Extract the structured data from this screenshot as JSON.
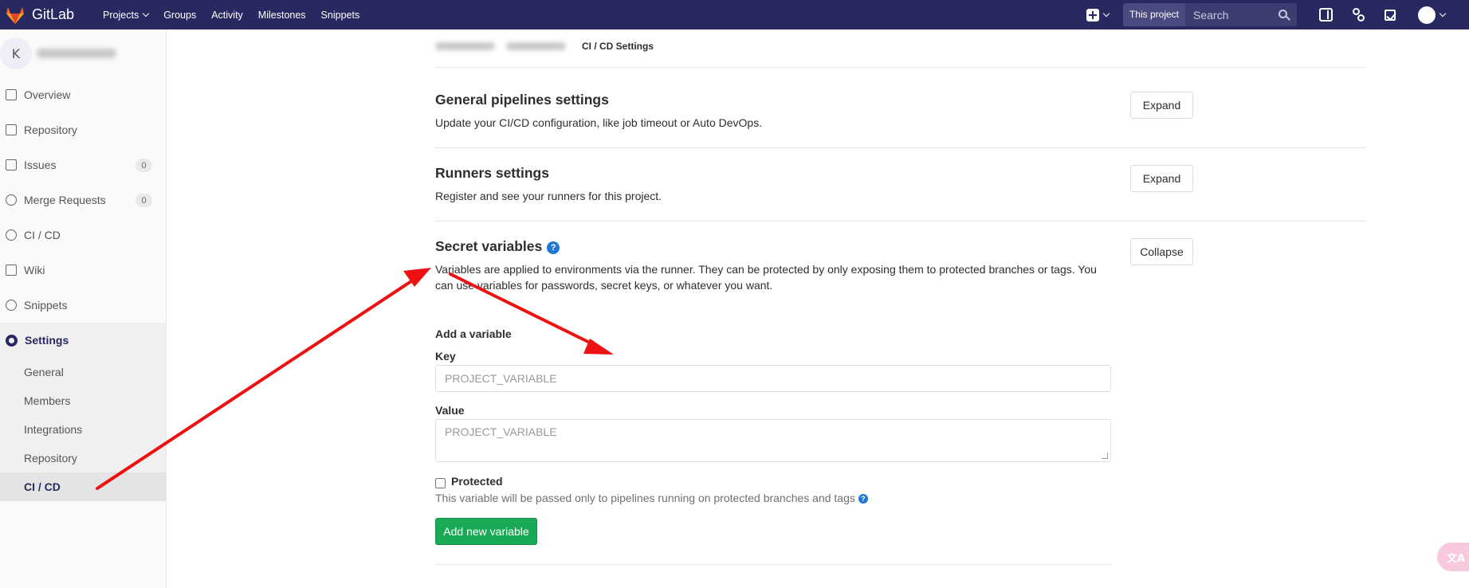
{
  "navbar": {
    "brand": "GitLab",
    "links": [
      "Projects",
      "Groups",
      "Activity",
      "Milestones",
      "Snippets"
    ],
    "scope": "This project",
    "search_placeholder": "Search"
  },
  "sidebar": {
    "project_initial": "K",
    "items": [
      {
        "label": "Overview",
        "icon": "home-icon"
      },
      {
        "label": "Repository",
        "icon": "doc-icon"
      },
      {
        "label": "Issues",
        "icon": "issues-icon",
        "badge": "0"
      },
      {
        "label": "Merge Requests",
        "icon": "merge-request-icon",
        "badge": "0"
      },
      {
        "label": "CI / CD",
        "icon": "rocket-icon"
      },
      {
        "label": "Wiki",
        "icon": "book-icon"
      },
      {
        "label": "Snippets",
        "icon": "scissors-icon"
      }
    ],
    "settings_label": "Settings",
    "settings_sub": [
      "General",
      "Members",
      "Integrations",
      "Repository",
      "CI / CD"
    ]
  },
  "breadcrumb": {
    "current": "CI / CD Settings"
  },
  "sections": {
    "general": {
      "title": "General pipelines settings",
      "desc": "Update your CI/CD configuration, like job timeout or Auto DevOps.",
      "button": "Expand"
    },
    "runners": {
      "title": "Runners settings",
      "desc": "Register and see your runners for this project.",
      "button": "Expand"
    },
    "secret": {
      "title": "Secret variables",
      "desc_line1": "Variables are applied to environments via the runner. They can be protected by only exposing them to protected branches or tags. You",
      "desc_line2": "can use variables for passwords, secret keys, or whatever you want.",
      "button": "Collapse"
    }
  },
  "form": {
    "heading": "Add a variable",
    "key_label": "Key",
    "key_placeholder": "PROJECT_VARIABLE",
    "value_label": "Value",
    "value_placeholder": "PROJECT_VARIABLE",
    "protected_label": "Protected",
    "protected_help": "This variable will be passed only to pipelines running on protected branches and tags",
    "submit": "Add new variable"
  },
  "colors": {
    "navbar": "#292961",
    "accent_green": "#1aaa55",
    "help_blue": "#1f78d1",
    "annotation_red": "#ee1111"
  }
}
